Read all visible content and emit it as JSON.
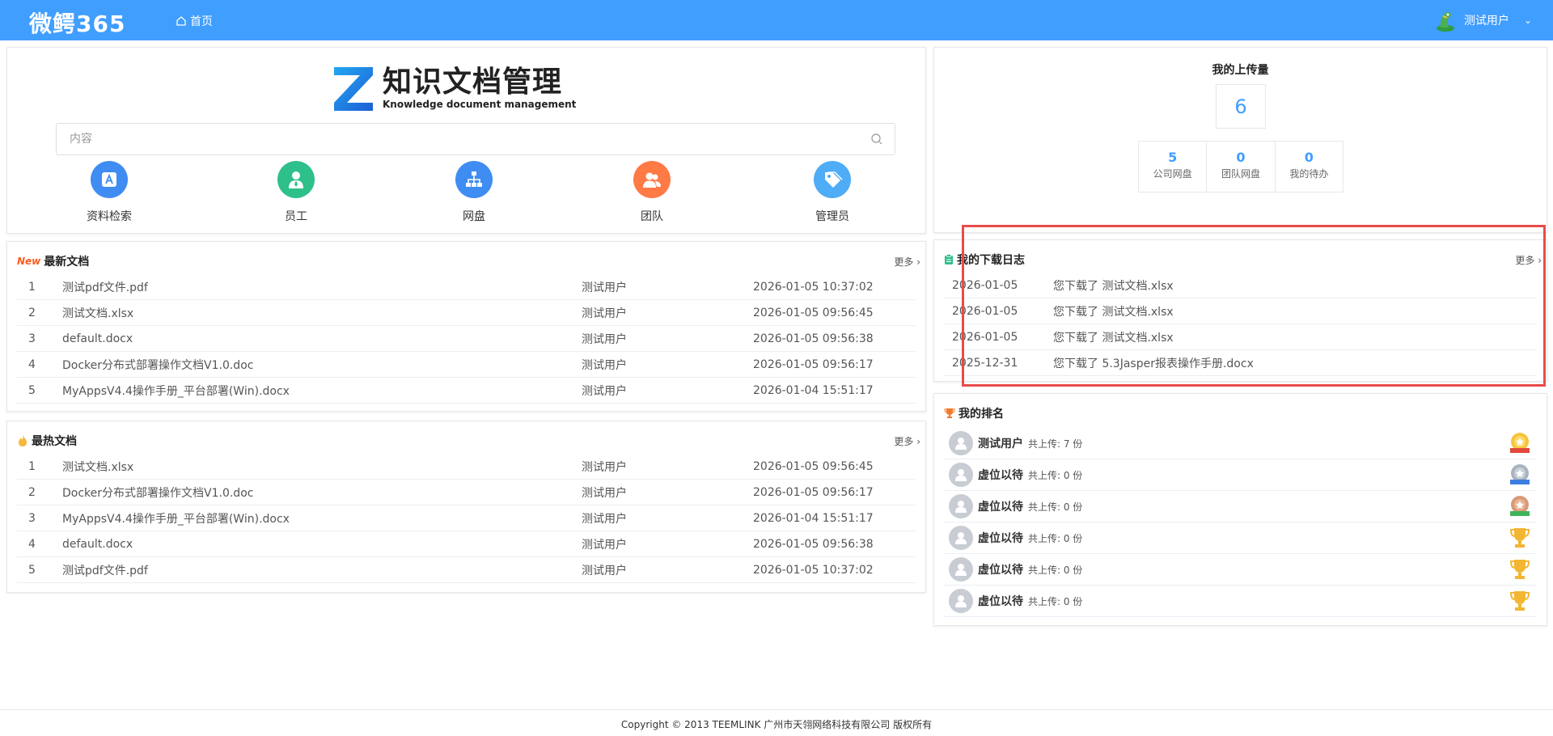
{
  "header": {
    "logo": "微鳄365",
    "nav_home": "首页",
    "user_name": "测试用户"
  },
  "hero": {
    "brand_cn": "知识文档管理",
    "brand_en": "Knowledge document management",
    "search_placeholder": "内容",
    "quick_links": [
      {
        "label": "资料检索",
        "icon": "search-doc-icon",
        "color": "#3f8cf3"
      },
      {
        "label": "员工",
        "icon": "employee-icon",
        "color": "#2ec08a"
      },
      {
        "label": "网盘",
        "icon": "network-disk-icon",
        "color": "#3f8cf3"
      },
      {
        "label": "团队",
        "icon": "team-icon",
        "color": "#ff7a45"
      },
      {
        "label": "管理员",
        "icon": "admin-tag-icon",
        "color": "#4facf7"
      }
    ]
  },
  "new_docs": {
    "title": "最新文档",
    "badge": "New",
    "more": "更多",
    "rows": [
      {
        "idx": "1",
        "name": "测试pdf文件.pdf",
        "user": "测试用户",
        "time": "2026-01-05 10:37:02"
      },
      {
        "idx": "2",
        "name": "测试文档.xlsx",
        "user": "测试用户",
        "time": "2026-01-05 09:56:45"
      },
      {
        "idx": "3",
        "name": "default.docx",
        "user": "测试用户",
        "time": "2026-01-05 09:56:38"
      },
      {
        "idx": "4",
        "name": "Docker分布式部署操作文档V1.0.doc",
        "user": "测试用户",
        "time": "2026-01-05 09:56:17"
      },
      {
        "idx": "5",
        "name": "MyAppsV4.4操作手册_平台部署(Win).docx",
        "user": "测试用户",
        "time": "2026-01-04 15:51:17"
      }
    ]
  },
  "hot_docs": {
    "title": "最热文档",
    "more": "更多",
    "rows": [
      {
        "idx": "1",
        "name": "测试文档.xlsx",
        "user": "测试用户",
        "time": "2026-01-05 09:56:45"
      },
      {
        "idx": "2",
        "name": "Docker分布式部署操作文档V1.0.doc",
        "user": "测试用户",
        "time": "2026-01-05 09:56:17"
      },
      {
        "idx": "3",
        "name": "MyAppsV4.4操作手册_平台部署(Win).docx",
        "user": "测试用户",
        "time": "2026-01-04 15:51:17"
      },
      {
        "idx": "4",
        "name": "default.docx",
        "user": "测试用户",
        "time": "2026-01-05 09:56:38"
      },
      {
        "idx": "5",
        "name": "测试pdf文件.pdf",
        "user": "测试用户",
        "time": "2026-01-05 10:37:02"
      }
    ]
  },
  "uploads": {
    "title": "我的上传量",
    "total": "6",
    "stats": [
      {
        "value": "5",
        "label": "公司网盘"
      },
      {
        "value": "0",
        "label": "团队网盘"
      },
      {
        "value": "0",
        "label": "我的待办"
      }
    ]
  },
  "downloads": {
    "title": "我的下载日志",
    "more": "更多",
    "rows": [
      {
        "date": "2026-01-05",
        "text": "您下载了 测试文档.xlsx"
      },
      {
        "date": "2026-01-05",
        "text": "您下载了 测试文档.xlsx"
      },
      {
        "date": "2026-01-05",
        "text": "您下载了 测试文档.xlsx"
      },
      {
        "date": "2025-12-31",
        "text": "您下载了 5.3Jasper报表操作手册.docx"
      }
    ]
  },
  "ranking": {
    "title": "我的排名",
    "rows": [
      {
        "name": "测试用户",
        "count": "共上传: 7 份",
        "medal": "gold-medal-icon"
      },
      {
        "name": "虚位以待",
        "count": "共上传: 0 份",
        "medal": "silver-medal-icon"
      },
      {
        "name": "虚位以待",
        "count": "共上传: 0 份",
        "medal": "bronze-medal-icon"
      },
      {
        "name": "虚位以待",
        "count": "共上传: 0 份",
        "medal": "trophy-icon"
      },
      {
        "name": "虚位以待",
        "count": "共上传: 0 份",
        "medal": "trophy-icon"
      },
      {
        "name": "虚位以待",
        "count": "共上传: 0 份",
        "medal": "trophy-icon"
      }
    ]
  },
  "footer": {
    "text": "Copyright © 2013 TEEMLINK 广州市天翎网络科技有限公司 版权所有"
  }
}
